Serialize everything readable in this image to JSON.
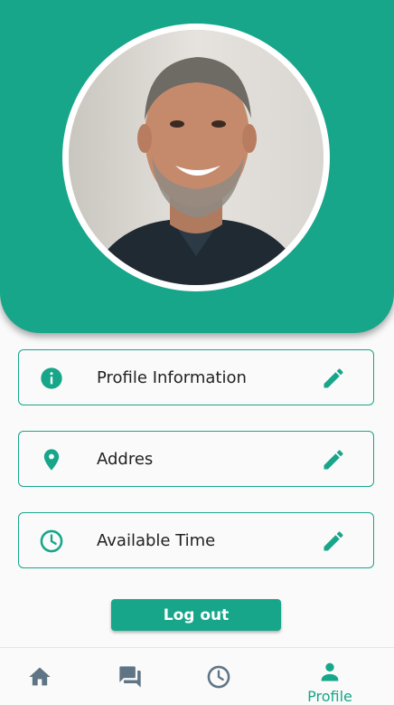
{
  "colors": {
    "accent": "#17a68a",
    "nav_inactive": "#5f7585",
    "background": "#fafafa"
  },
  "profile": {
    "avatar_alt": "profile photo"
  },
  "cards": [
    {
      "label": "Profile Information",
      "icon": "info-icon",
      "action_icon": "edit-pencil-icon"
    },
    {
      "label": "Addres",
      "icon": "location-pin-icon",
      "action_icon": "edit-pencil-icon"
    },
    {
      "label": "Available Time",
      "icon": "clock-icon",
      "action_icon": "edit-pencil-icon"
    }
  ],
  "logout": {
    "label": "Log out"
  },
  "bottom_nav": {
    "items": [
      {
        "icon": "home-icon",
        "label": ""
      },
      {
        "icon": "chat-icon",
        "label": ""
      },
      {
        "icon": "clock-icon",
        "label": ""
      },
      {
        "icon": "person-icon",
        "label": "Profile",
        "active": true
      }
    ]
  }
}
